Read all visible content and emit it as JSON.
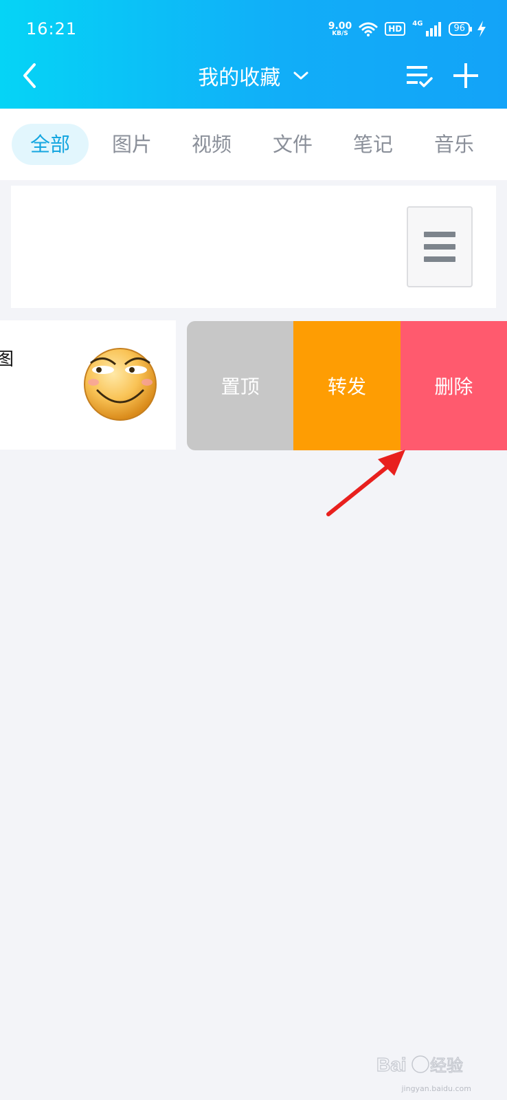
{
  "status_bar": {
    "time": "16:21",
    "net_speed_value": "9.00",
    "net_speed_unit": "KB/S",
    "hd_label": "HD",
    "signal_label": "4G",
    "battery": "96"
  },
  "header": {
    "title": "我的收藏"
  },
  "tabs": [
    {
      "label": "全部",
      "active": true
    },
    {
      "label": "图片",
      "active": false
    },
    {
      "label": "视频",
      "active": false
    },
    {
      "label": "文件",
      "active": false
    },
    {
      "label": "笔记",
      "active": false
    },
    {
      "label": "音乐",
      "active": false
    }
  ],
  "items": {
    "partial_text": "图"
  },
  "swipe_actions": {
    "pin": "置顶",
    "forward": "转发",
    "delete": "删除"
  },
  "watermark": {
    "brand": "Baidu 经验",
    "url": "jingyan.baidu.com"
  },
  "colors": {
    "header_gradient_start": "#05d4f6",
    "header_gradient_end": "#13a3f8",
    "tab_active_text": "#15a6e0",
    "pin_bg": "#c7c7c7",
    "forward_bg": "#fe9d03",
    "delete_bg": "#ff5a6e",
    "arrow": "#e8201e"
  }
}
